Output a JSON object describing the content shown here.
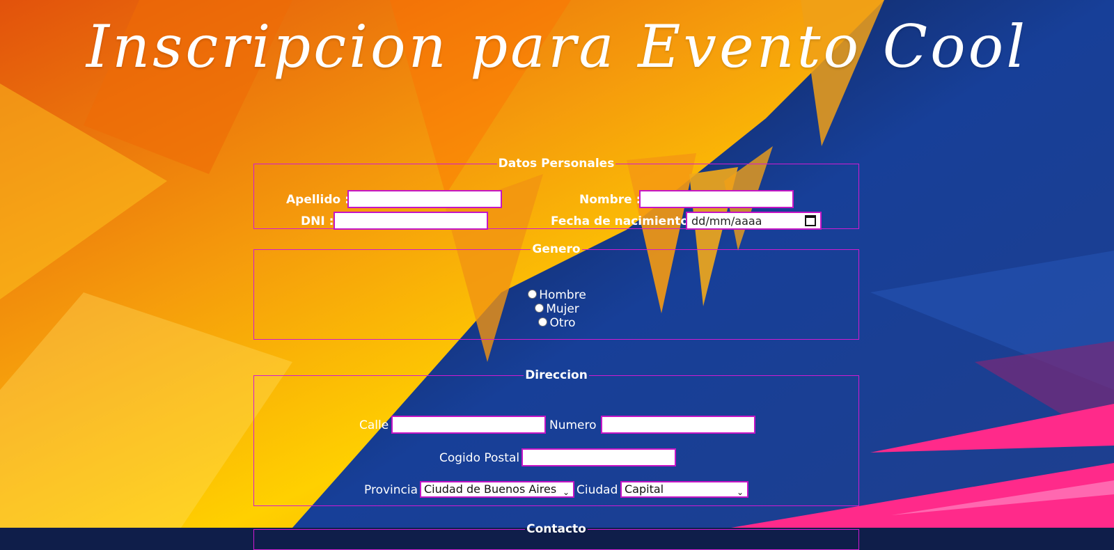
{
  "title": "Inscripcion para Evento Cool",
  "personal": {
    "legend": "Datos Personales",
    "apellido_label": "Apellido :",
    "nombre_label": "Nombre :",
    "dni_label": "DNI :",
    "fecha_label": "Fecha de nacimiento :",
    "fecha_placeholder": "dd/mm/aaaa"
  },
  "genero": {
    "legend": "Genero",
    "options": [
      "Hombre",
      "Mujer",
      "Otro"
    ]
  },
  "direccion": {
    "legend": "Direccion",
    "calle_label": "Calle",
    "numero_label": "Numero",
    "cp_label": "Cogido Postal",
    "provincia_label": "Provincia",
    "provincia_value": "Ciudad de Buenos Aires",
    "ciudad_label": "Ciudad",
    "ciudad_value": "Capital"
  },
  "contacto": {
    "legend": "Contacto"
  },
  "colors": {
    "border": "#d11bd1",
    "orange": "#f39a00",
    "navy": "#0f1e4a",
    "pink": "#ff2a8a"
  }
}
